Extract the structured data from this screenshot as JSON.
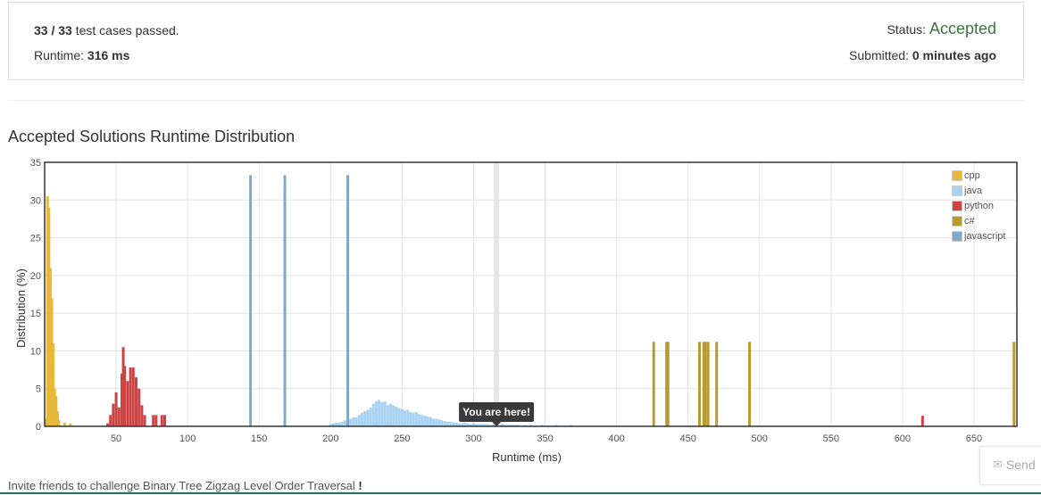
{
  "result": {
    "passed": "33",
    "sep": "/",
    "total": "33",
    "passed_suffix": "test cases passed.",
    "runtime_label": "Runtime:",
    "runtime_value": "316 ms",
    "status_label": "Status:",
    "status_value": "Accepted",
    "submitted_label": "Submitted:",
    "submitted_value": "0 minutes ago",
    "status_color": "#3c763d"
  },
  "chart_data": {
    "type": "bar",
    "title": "Accepted Solutions Runtime Distribution",
    "xlabel": "Runtime (ms)",
    "ylabel": "Distribution (%)",
    "xlim": [
      0,
      680
    ],
    "ylim": [
      0,
      35
    ],
    "x_ticks": [
      50,
      100,
      150,
      200,
      250,
      300,
      350,
      400,
      450,
      500,
      550,
      600,
      650
    ],
    "y_ticks": [
      0,
      5,
      10,
      15,
      20,
      25,
      30,
      35
    ],
    "grid": true,
    "legend_position": "top-right",
    "marker": {
      "x": 316,
      "label": "You are here!"
    },
    "series": [
      {
        "name": "cpp",
        "color": "#e8b83b",
        "points": [
          [
            1,
            1
          ],
          [
            2,
            30.5
          ],
          [
            3,
            29
          ],
          [
            4,
            21
          ],
          [
            5,
            17
          ],
          [
            6,
            11
          ],
          [
            7,
            5
          ],
          [
            8,
            4
          ],
          [
            9,
            2
          ],
          [
            10,
            0.8
          ],
          [
            14,
            0.5
          ],
          [
            18,
            0.4
          ]
        ]
      },
      {
        "name": "java",
        "color": "#a9d2f2",
        "points": [
          [
            200,
            0.3
          ],
          [
            202,
            0.4
          ],
          [
            204,
            0.5
          ],
          [
            206,
            0.5
          ],
          [
            208,
            0.6
          ],
          [
            210,
            0.8
          ],
          [
            212,
            1
          ],
          [
            214,
            1
          ],
          [
            216,
            1.2
          ],
          [
            218,
            1.2
          ],
          [
            220,
            1.5
          ],
          [
            222,
            1.8
          ],
          [
            224,
            2
          ],
          [
            226,
            2.2
          ],
          [
            228,
            2.5
          ],
          [
            230,
            3
          ],
          [
            232,
            3.3
          ],
          [
            234,
            3.5
          ],
          [
            236,
            3.2
          ],
          [
            238,
            3.3
          ],
          [
            240,
            2.8
          ],
          [
            242,
            3
          ],
          [
            244,
            2.8
          ],
          [
            246,
            2.6
          ],
          [
            248,
            2.4
          ],
          [
            250,
            2.3
          ],
          [
            252,
            2.1
          ],
          [
            254,
            2.2
          ],
          [
            256,
            1.9
          ],
          [
            258,
            1.8
          ],
          [
            260,
            1.9
          ],
          [
            262,
            1.6
          ],
          [
            264,
            1.5
          ],
          [
            266,
            1.4
          ],
          [
            268,
            1.3
          ],
          [
            270,
            1.2
          ],
          [
            272,
            1
          ],
          [
            274,
            1
          ],
          [
            276,
            0.9
          ],
          [
            278,
            0.8
          ],
          [
            280,
            0.7
          ],
          [
            282,
            0.6
          ],
          [
            284,
            0.6
          ],
          [
            286,
            0.5
          ],
          [
            288,
            0.5
          ],
          [
            290,
            0.4
          ],
          [
            292,
            0.4
          ],
          [
            294,
            0.5
          ],
          [
            296,
            0.4
          ],
          [
            298,
            0.3
          ],
          [
            300,
            0.4
          ],
          [
            302,
            0.3
          ],
          [
            304,
            0.3
          ],
          [
            306,
            0.3
          ],
          [
            308,
            0.3
          ],
          [
            310,
            0.3
          ],
          [
            312,
            0.2
          ],
          [
            314,
            0.3
          ],
          [
            318,
            0.2
          ],
          [
            320,
            0.3
          ],
          [
            322,
            0.2
          ],
          [
            324,
            0.2
          ],
          [
            326,
            0.2
          ],
          [
            328,
            0.2
          ],
          [
            330,
            0.2
          ],
          [
            332,
            0.2
          ],
          [
            336,
            0.2
          ],
          [
            340,
            0.2
          ],
          [
            348,
            0.2
          ],
          [
            358,
            0.2
          ],
          [
            368,
            0.2
          ]
        ]
      },
      {
        "name": "python",
        "color": "#cc4444",
        "points": [
          [
            44,
            0.4
          ],
          [
            46,
            1.5
          ],
          [
            48,
            3
          ],
          [
            50,
            4.5
          ],
          [
            52,
            2.5
          ],
          [
            54,
            7
          ],
          [
            55,
            10.5
          ],
          [
            56,
            8
          ],
          [
            58,
            6
          ],
          [
            60,
            7.8
          ],
          [
            62,
            7.8
          ],
          [
            64,
            6.5
          ],
          [
            66,
            5
          ],
          [
            68,
            2.8
          ],
          [
            70,
            1.5
          ],
          [
            76,
            1.5
          ],
          [
            78,
            1.5
          ],
          [
            82,
            1.5
          ],
          [
            84,
            1.5
          ]
        ]
      },
      {
        "name": "c#",
        "color": "#b89a30",
        "points": [
          [
            426,
            11.2
          ],
          [
            435,
            11.2
          ],
          [
            436,
            11.2
          ],
          [
            458,
            11.2
          ],
          [
            461,
            11.2
          ],
          [
            462,
            11.2
          ],
          [
            464,
            11.2
          ],
          [
            470,
            11.2
          ],
          [
            493,
            11.2
          ],
          [
            678,
            11.2
          ]
        ]
      },
      {
        "name": "javascript",
        "color": "#82a8c7",
        "points": [
          [
            144,
            33.3
          ],
          [
            168,
            33.3
          ],
          [
            212,
            33.3
          ]
        ]
      },
      {
        "name": "",
        "color": "#cc4444",
        "points": [
          [
            614,
            1.4
          ]
        ]
      }
    ]
  },
  "footer": {
    "text": "Invite friends to challenge Binary Tree Zigzag Level Order Traversal",
    "bang": "!"
  },
  "send": {
    "icon": "mail-icon",
    "label": "Send"
  }
}
